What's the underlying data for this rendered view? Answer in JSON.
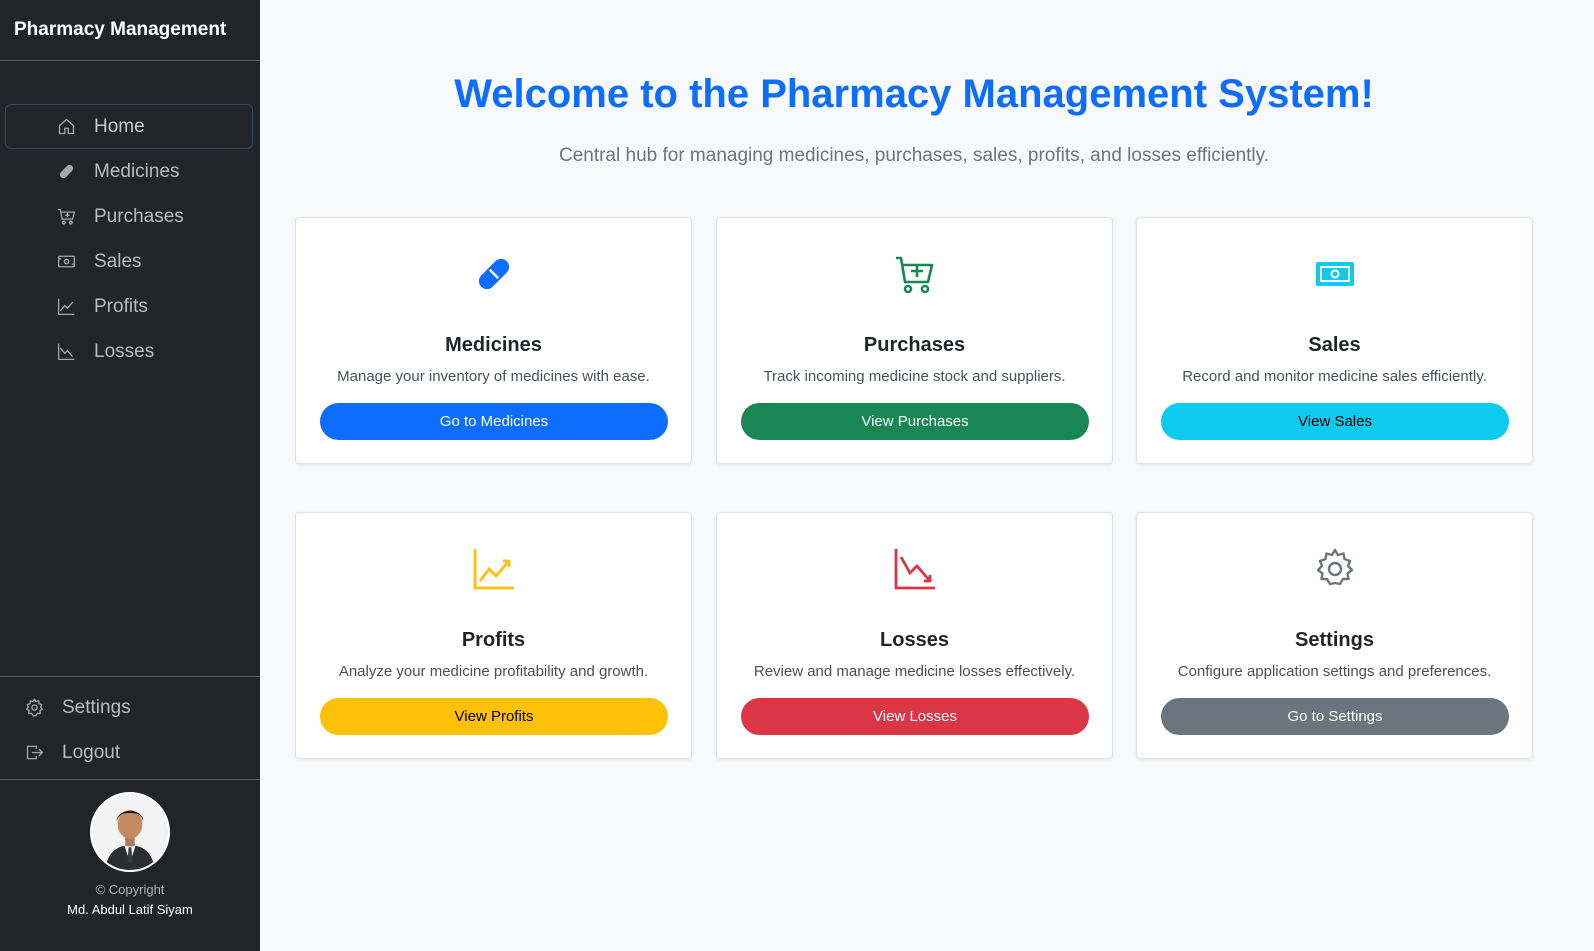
{
  "sidebar": {
    "brand": "Pharmacy Management",
    "nav": [
      {
        "label": "Home",
        "icon": "home-icon"
      },
      {
        "label": "Medicines",
        "icon": "capsule-icon"
      },
      {
        "label": "Purchases",
        "icon": "cart-icon"
      },
      {
        "label": "Sales",
        "icon": "cash-icon"
      },
      {
        "label": "Profits",
        "icon": "graph-up-icon"
      },
      {
        "label": "Losses",
        "icon": "graph-down-icon"
      }
    ],
    "bottom": [
      {
        "label": "Settings",
        "icon": "gear-icon"
      },
      {
        "label": "Logout",
        "icon": "logout-icon"
      }
    ],
    "copyright": "© Copyright",
    "author": "Md. Abdul Latif Siyam"
  },
  "main": {
    "title": "Welcome to the Pharmacy Management System!",
    "subtitle": "Central hub for managing medicines, purchases, sales, profits, and losses efficiently.",
    "cards": [
      {
        "title": "Medicines",
        "desc": "Manage your inventory of medicines with ease.",
        "button": "Go to Medicines",
        "icon": "capsule-icon",
        "color": "#0d6efd",
        "btn_text_color": "#ffffff"
      },
      {
        "title": "Purchases",
        "desc": "Track incoming medicine stock and suppliers.",
        "button": "View Purchases",
        "icon": "cart-plus-icon",
        "color": "#198754",
        "btn_text_color": "#ffffff"
      },
      {
        "title": "Sales",
        "desc": "Record and monitor medicine sales efficiently.",
        "button": "View Sales",
        "icon": "cash-icon",
        "color": "#0dcaf0",
        "btn_text_color": "#000000"
      },
      {
        "title": "Profits",
        "desc": "Analyze your medicine profitability and growth.",
        "button": "View Profits",
        "icon": "graph-up-icon",
        "color": "#ffc107",
        "btn_text_color": "#000000"
      },
      {
        "title": "Losses",
        "desc": "Review and manage medicine losses effectively.",
        "button": "View Losses",
        "icon": "graph-down-icon",
        "color": "#dc3545",
        "btn_text_color": "#ffffff"
      },
      {
        "title": "Settings",
        "desc": "Configure application settings and preferences.",
        "button": "Go to Settings",
        "icon": "gear-icon",
        "color": "#6c757d",
        "btn_text_color": "#ffffff"
      }
    ]
  }
}
